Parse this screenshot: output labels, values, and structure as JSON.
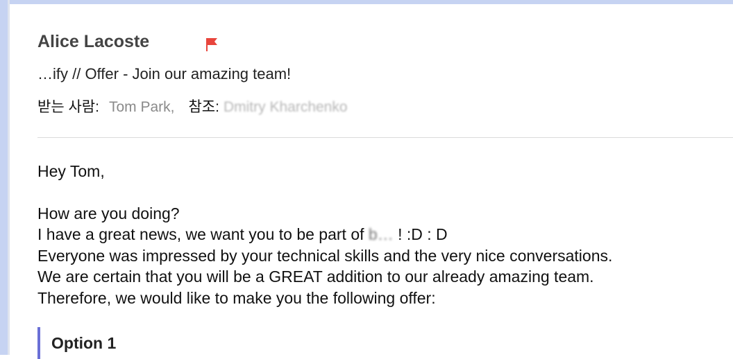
{
  "email": {
    "sender_name": "Alice Lacoste",
    "subject": "…ify // Offer - Join our amazing team!",
    "recipients": {
      "to_label": "받는 사람:",
      "to": "Tom Park,",
      "cc_label": "참조:",
      "cc": "Dmitry Kharchenko"
    }
  },
  "body": {
    "greeting": "Hey Tom,",
    "line1": "How are you doing?",
    "line2_prefix": "I have a great news, we want you to be part of",
    "line2_company": "b…",
    "line2_suffix": "! :D : D",
    "line3": "Everyone was impressed by your technical skills and the very nice conversations.",
    "line4": "We are certain that you will be a GREAT addition to our already amazing team.",
    "line5": "Therefore, we would like to make you the following offer:",
    "option_title": "Option 1"
  },
  "colors": {
    "flag": "#e8453c",
    "quote_bar": "#6a6fd6",
    "window_border": "#c6d3f2"
  },
  "icons": {
    "flag": "flag-icon"
  }
}
